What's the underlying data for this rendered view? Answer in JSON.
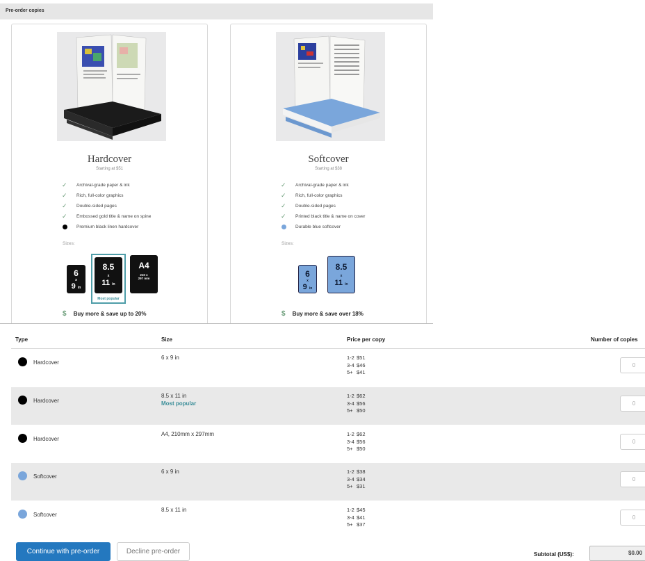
{
  "header": {
    "title": "Pre-order copies"
  },
  "cards": {
    "hardcover": {
      "title": "Hardcover",
      "subtitle": "Starting at $51",
      "features": [
        "Archival-grade paper & ink",
        "Rich, full-color graphics",
        "Double-sided pages",
        "Embossed gold title & name on spine",
        "Premium black linen hardcover"
      ],
      "sizes_label": "Sizes:",
      "sizes": [
        {
          "top": "6",
          "x": "x",
          "bottom": "9",
          "unit": "in"
        },
        {
          "top": "8.5",
          "x": "x",
          "bottom": "11",
          "unit": "in",
          "badge": "Most popular"
        },
        {
          "top": "A4",
          "sub1": "210 x",
          "sub2": "297 mm"
        }
      ],
      "save": "Buy more & save up to 20%",
      "dot_color": "#000000"
    },
    "softcover": {
      "title": "Softcover",
      "subtitle": "Starting at $38",
      "features": [
        "Archival-grade paper & ink",
        "Rich, full-color graphics",
        "Double-sided pages",
        "Printed black title & name on cover",
        "Durable blue softcover"
      ],
      "sizes_label": "Sizes:",
      "sizes": [
        {
          "top": "6",
          "x": "x",
          "bottom": "9",
          "unit": "in"
        },
        {
          "top": "8.5",
          "x": "x",
          "bottom": "11",
          "unit": "in"
        }
      ],
      "save": "Buy more & save over 18%",
      "dot_color": "#7aa6db"
    }
  },
  "table": {
    "headers": {
      "type": "Type",
      "size": "Size",
      "price": "Price per copy",
      "copies": "Number of copies"
    },
    "rows": [
      {
        "type": "Hardcover",
        "size": "6 x 9 in",
        "badge": "",
        "prices": [
          [
            "1-2",
            "$51"
          ],
          [
            "3-4",
            "$46"
          ],
          [
            "5+",
            "$41"
          ]
        ],
        "qty": "0",
        "color": "#000000"
      },
      {
        "type": "Hardcover",
        "size": "8.5 x 11 in",
        "badge": "Most popular",
        "prices": [
          [
            "1-2",
            "$62"
          ],
          [
            "3-4",
            "$56"
          ],
          [
            "5+",
            "$50"
          ]
        ],
        "qty": "0",
        "color": "#000000"
      },
      {
        "type": "Hardcover",
        "size": "A4, 210mm x 297mm",
        "badge": "",
        "prices": [
          [
            "1-2",
            "$62"
          ],
          [
            "3-4",
            "$56"
          ],
          [
            "5+",
            "$50"
          ]
        ],
        "qty": "0",
        "color": "#000000"
      },
      {
        "type": "Softcover",
        "size": "6 x 9 in",
        "badge": "",
        "prices": [
          [
            "1-2",
            "$38"
          ],
          [
            "3-4",
            "$34"
          ],
          [
            "5+",
            "$31"
          ]
        ],
        "qty": "0",
        "color": "#7aa6db"
      },
      {
        "type": "Softcover",
        "size": "8.5 x 11 in",
        "badge": "",
        "prices": [
          [
            "1-2",
            "$45"
          ],
          [
            "3-4",
            "$41"
          ],
          [
            "5+",
            "$37"
          ]
        ],
        "qty": "0",
        "color": "#7aa6db"
      }
    ]
  },
  "footer": {
    "continue_label": "Continue with pre-order",
    "decline_label": "Decline pre-order",
    "subtotal_label": "Subtotal (US$):",
    "subtotal_value": "$0.00"
  },
  "colors": {
    "accent": "#2478bf",
    "popular": "#3b8e99",
    "check": "#6a9c78"
  }
}
